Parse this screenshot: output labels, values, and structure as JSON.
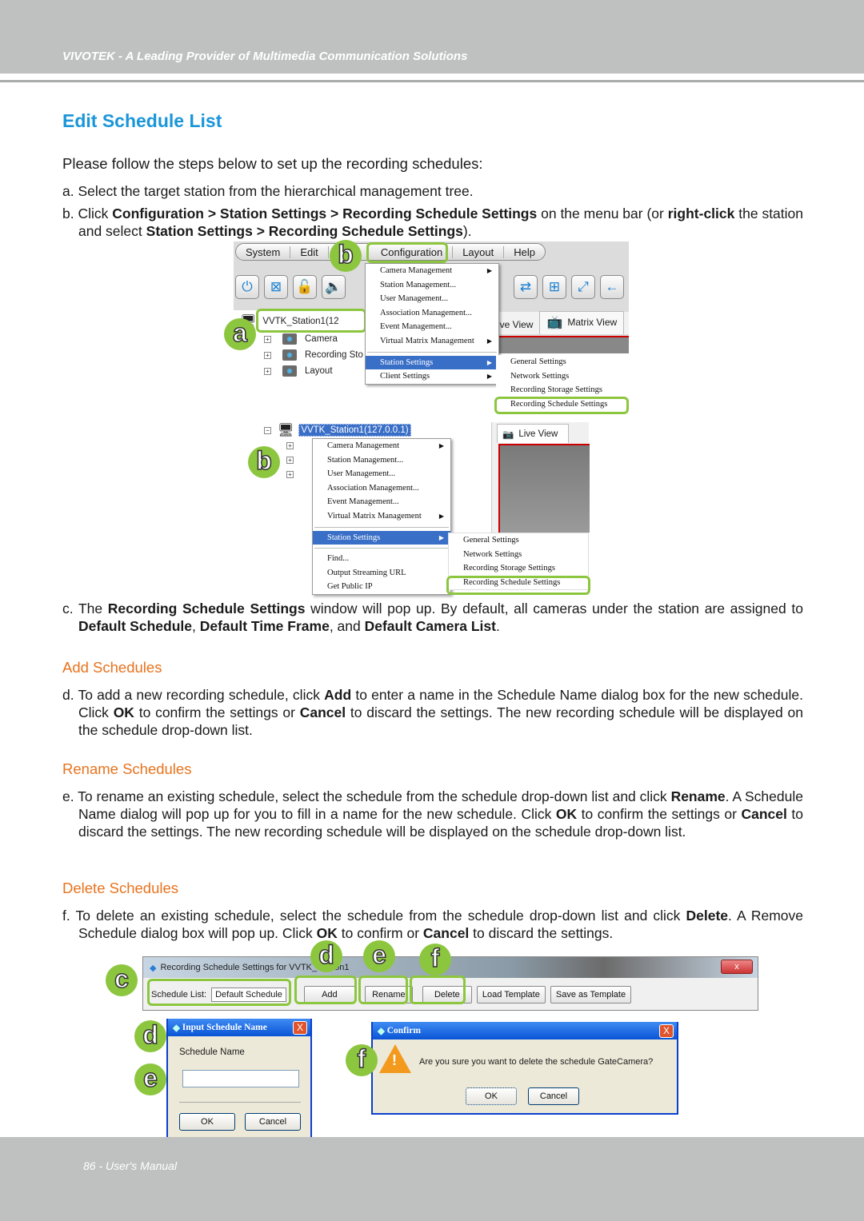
{
  "header": {
    "text": "VIVOTEK - A Leading Provider of Multimedia Communication Solutions"
  },
  "title": "Edit Schedule List",
  "intro": "Please follow the steps below to set up the recording schedules:",
  "steps": {
    "a": "a. Select the target station from the hierarchical management tree.",
    "b": {
      "t1": "b. Click ",
      "b1": "Configuration > Station Settings > Recording Schedule Settings",
      "t2": " on the menu bar (or ",
      "b2": "right-click",
      "t3": " the station and select ",
      "b3": "Station Settings > Recording Schedule Settings",
      "t4": ")."
    },
    "c": {
      "t1": "c. The ",
      "b1": "Recording Schedule Settings",
      "t2": " window will pop up. By default, all cameras under the station are assigned to ",
      "b2": "Default Schedule",
      "t3": ", ",
      "b3": "Default Time Frame",
      "t4": ", and ",
      "b4": "Default Camera List",
      "t5": "."
    },
    "d": {
      "t1": "d. To add a new recording schedule, click ",
      "b1": "Add",
      "t2": " to enter a name in the Schedule Name dialog box for the new schedule. Click ",
      "b2": "OK",
      "t3": " to confirm the settings or ",
      "b3": "Cancel",
      "t4": " to discard the settings. The new recording schedule will be displayed on the schedule drop-down list."
    },
    "e": {
      "t1": "e. To rename an existing schedule, select the schedule from the schedule drop-down list and click ",
      "b1": "Rename",
      "t2": ". A Schedule Name dialog will pop up for you to fill in a name for the new schedule. Click ",
      "b2": "OK",
      "t3": " to confirm the settings or ",
      "b3": "Cancel",
      "t4": " to discard the settings. The new recording schedule will be displayed on the schedule drop-down list."
    },
    "f": {
      "t1": "f. To delete an existing schedule, select the schedule from the schedule drop-down list and click ",
      "b1": "Delete",
      "t2": ". A Remove Schedule dialog box will pop up. Click ",
      "b2": "OK",
      "t3": " to confirm or ",
      "b3": "Cancel",
      "t4": " to discard the settings."
    }
  },
  "subheads": {
    "add": "Add Schedules",
    "rename": "Rename Schedules",
    "delete": "Delete Schedules"
  },
  "badges": {
    "a": "a",
    "b": "b",
    "c": "c",
    "d": "d",
    "e": "e",
    "f": "f"
  },
  "shot1": {
    "menubar": [
      "System",
      "Edit",
      "Configuration",
      "Layout",
      "Help"
    ],
    "station": "VVTK_Station1(12",
    "tree": [
      "Camera",
      "Recording Sto",
      "Layout"
    ],
    "tabs": [
      "ive View",
      "Matrix View"
    ],
    "config_menu": [
      "Camera Management",
      "Station Management...",
      "User Management...",
      "Association Management...",
      "Event Management...",
      "Virtual Matrix Management",
      "Station Settings",
      "Client Settings"
    ],
    "submenu": [
      "General Settings",
      "Network Settings",
      "Recording Storage Settings",
      "Recording Schedule Settings"
    ]
  },
  "shot2": {
    "station": "VVTK_Station1(127.0.0.1)",
    "tab": "Live View",
    "context_menu": [
      "Camera Management",
      "Station Management...",
      "User Management...",
      "Association Management...",
      "Event Management...",
      "Virtual Matrix Management",
      "Station Settings",
      "Find...",
      "Output Streaming URL",
      "Get Public IP"
    ],
    "submenu": [
      "General Settings",
      "Network Settings",
      "Recording Storage Settings",
      "Recording Schedule Settings"
    ]
  },
  "shot3": {
    "window_title": "Recording Schedule Settings for VVTK_Station1",
    "schedule_list_label": "Schedule List:",
    "schedule_list_value": "Default Schedule",
    "buttons": [
      "Add",
      "Rename",
      "Delete",
      "Load Template",
      "Save as Template"
    ],
    "close": "x"
  },
  "dialog_input": {
    "title": "Input Schedule Name",
    "label": "Schedule Name",
    "value": "",
    "ok": "OK",
    "cancel": "Cancel",
    "close": "X"
  },
  "dialog_confirm": {
    "title": "Confirm",
    "message": "Are you sure you want to delete the schedule GateCamera?",
    "ok": "OK",
    "cancel": "Cancel",
    "close": "X"
  },
  "footer": {
    "text": "86 - User's Manual"
  }
}
